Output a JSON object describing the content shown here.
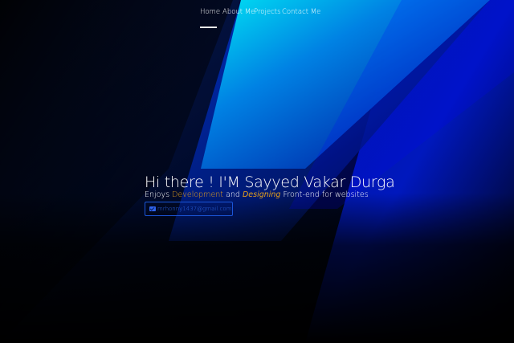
{
  "nav": {
    "items": [
      {
        "label": "Home",
        "active": true
      },
      {
        "label": "About Me",
        "active": false
      },
      {
        "label": "Projects",
        "active": false
      },
      {
        "label": "Contact Me",
        "active": false
      }
    ]
  },
  "hero": {
    "title": "Hi there ! I'M Sayyed Vakar Durga",
    "subtitle": {
      "prefix": "Enjoys ",
      "highlight1": "Development",
      "middle": " and ",
      "highlight2": "Designing",
      "suffix": " Front-end for websites"
    },
    "email": {
      "icon": "mail-icon",
      "text": "mrhonny1437@gmail.com"
    }
  },
  "colors": {
    "background": "#000000",
    "accent": "#e7a11b",
    "button_border": "#1b56d9",
    "button_text": "#2d69ee",
    "gradient_blue": "#0028d8",
    "gradient_cyan": "#00d8f2"
  }
}
